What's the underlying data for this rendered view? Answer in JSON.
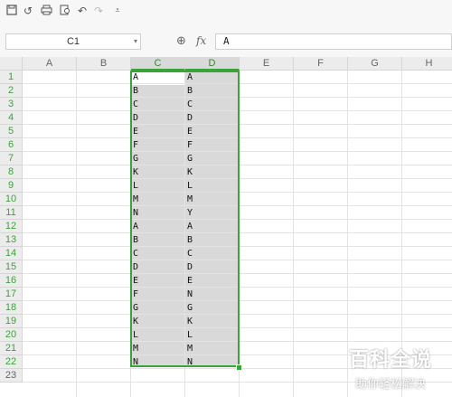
{
  "toolbar": {
    "icons": [
      "save-icon",
      "undo-history-icon",
      "print-icon",
      "print-preview-icon",
      "undo-icon",
      "redo-icon",
      "customize-toolbar-icon"
    ]
  },
  "formula_bar": {
    "cell_name": "C1",
    "formula": "A"
  },
  "columns": [
    "A",
    "B",
    "C",
    "D",
    "E",
    "F",
    "G",
    "H"
  ],
  "rows": [
    "1",
    "2",
    "3",
    "4",
    "5",
    "6",
    "7",
    "8",
    "9",
    "10",
    "11",
    "12",
    "13",
    "14",
    "15",
    "16",
    "17",
    "18",
    "19",
    "20",
    "21",
    "22",
    "23"
  ],
  "column_c": [
    "A",
    "B",
    "C",
    "D",
    "E",
    "F",
    "G",
    "K",
    "L",
    "M",
    "N",
    "A",
    "B",
    "C",
    "D",
    "E",
    "F",
    "G",
    "K",
    "L",
    "M",
    "N"
  ],
  "column_d": [
    "A",
    "B",
    "C",
    "D",
    "E",
    "F",
    "G",
    "K",
    "L",
    "M",
    "Y",
    "A",
    "B",
    "C",
    "D",
    "E",
    "N",
    "G",
    "K",
    "L",
    "M",
    "N"
  ],
  "colors": {
    "selection_border": "#3aa43a",
    "selection_fill": "#d9d9d9"
  },
  "watermark": {
    "title": "百科全说",
    "subtitle": "助你轻松解决"
  }
}
